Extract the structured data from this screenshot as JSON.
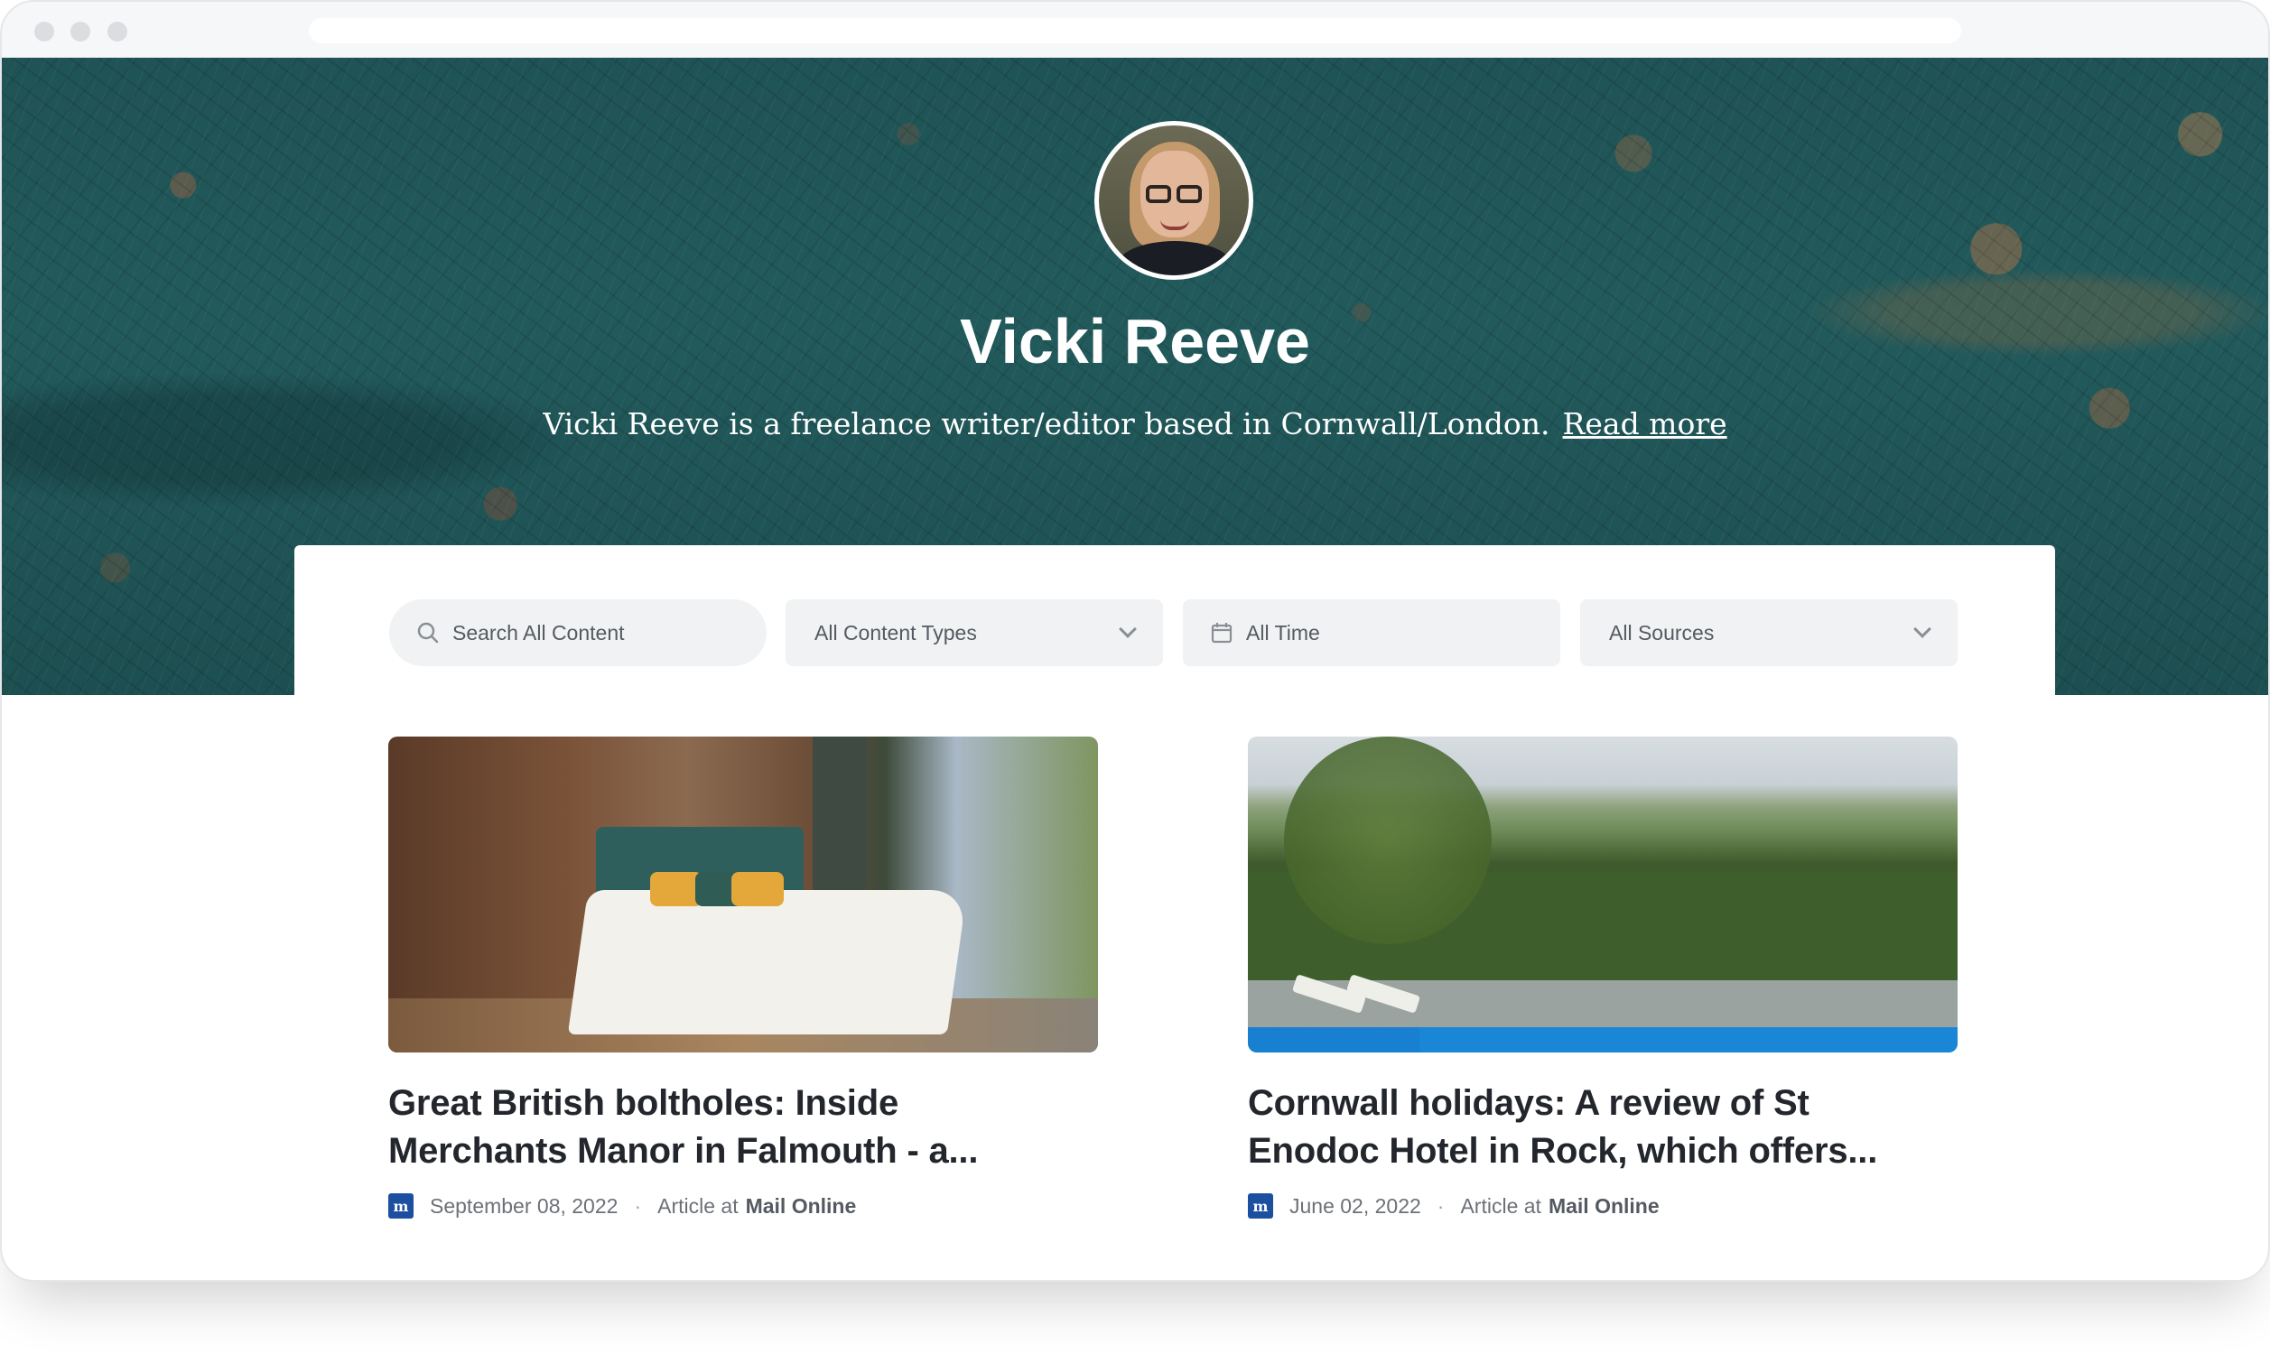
{
  "profile": {
    "name": "Vicki Reeve",
    "bio": "Vicki Reeve is a freelance writer/editor based in Cornwall/London.",
    "read_more_label": "Read more"
  },
  "filters": {
    "search_placeholder": "Search All Content",
    "content_types": "All Content Types",
    "time": "All Time",
    "sources": "All Sources"
  },
  "articles": [
    {
      "title_line1": "Great British boltholes: Inside",
      "title_line2": "Merchants Manor in Falmouth - a...",
      "date": "September 08, 2022",
      "type": "Article at",
      "source": "Mail Online",
      "source_icon_text": "m"
    },
    {
      "title_line1": "Cornwall holidays: A review of St",
      "title_line2": "Enodoc Hotel in Rock, which offers...",
      "date": "June 02, 2022",
      "type": "Article at",
      "source": "Mail Online",
      "source_icon_text": "m"
    }
  ],
  "separator": "·",
  "colors": {
    "hero_teal": "#1f5355",
    "source_icon_blue": "#1c4fa0"
  }
}
